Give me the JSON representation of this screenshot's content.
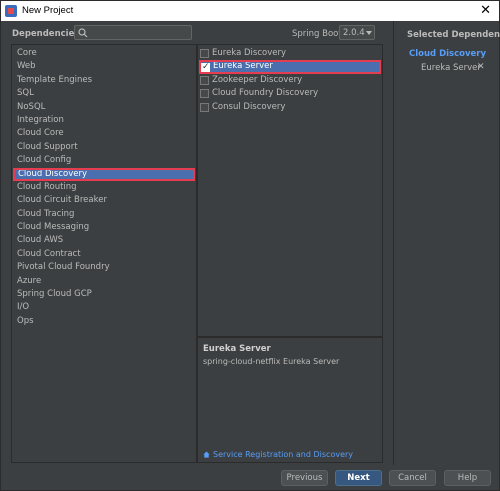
{
  "window": {
    "title": "New Project"
  },
  "header": {
    "dependencies_label": "Dependencies",
    "search_placeholder": "",
    "spring_boot_label": "Spring Boot",
    "spring_boot_version": "2.0.4"
  },
  "categories": [
    "Core",
    "Web",
    "Template Engines",
    "SQL",
    "NoSQL",
    "Integration",
    "Cloud Core",
    "Cloud Support",
    "Cloud Config",
    "Cloud Discovery",
    "Cloud Routing",
    "Cloud Circuit Breaker",
    "Cloud Tracing",
    "Cloud Messaging",
    "Cloud AWS",
    "Cloud Contract",
    "Pivotal Cloud Foundry",
    "Azure",
    "Spring Cloud GCP",
    "I/O",
    "Ops"
  ],
  "selected_category": "Cloud Discovery",
  "dependencies": [
    {
      "label": "Eureka Discovery",
      "checked": false
    },
    {
      "label": "Eureka Server",
      "checked": true
    },
    {
      "label": "Zookeeper Discovery",
      "checked": false
    },
    {
      "label": "Cloud Foundry Discovery",
      "checked": false
    },
    {
      "label": "Consul Discovery",
      "checked": false
    }
  ],
  "info": {
    "title": "Eureka Server",
    "description": "spring-cloud-netflix Eureka Server",
    "link": "Service Registration and Discovery"
  },
  "selected": {
    "title": "Selected Dependencies",
    "group": "Cloud Discovery",
    "item": "Eureka Server",
    "remove_glyph": "✕"
  },
  "buttons": {
    "previous": "Previous",
    "next": "Next",
    "cancel": "Cancel",
    "help": "Help"
  },
  "colors": {
    "selection": "#4b6eaf",
    "highlight_outline": "#e33d4f",
    "link": "#589df6",
    "background": "#3c3f41"
  }
}
